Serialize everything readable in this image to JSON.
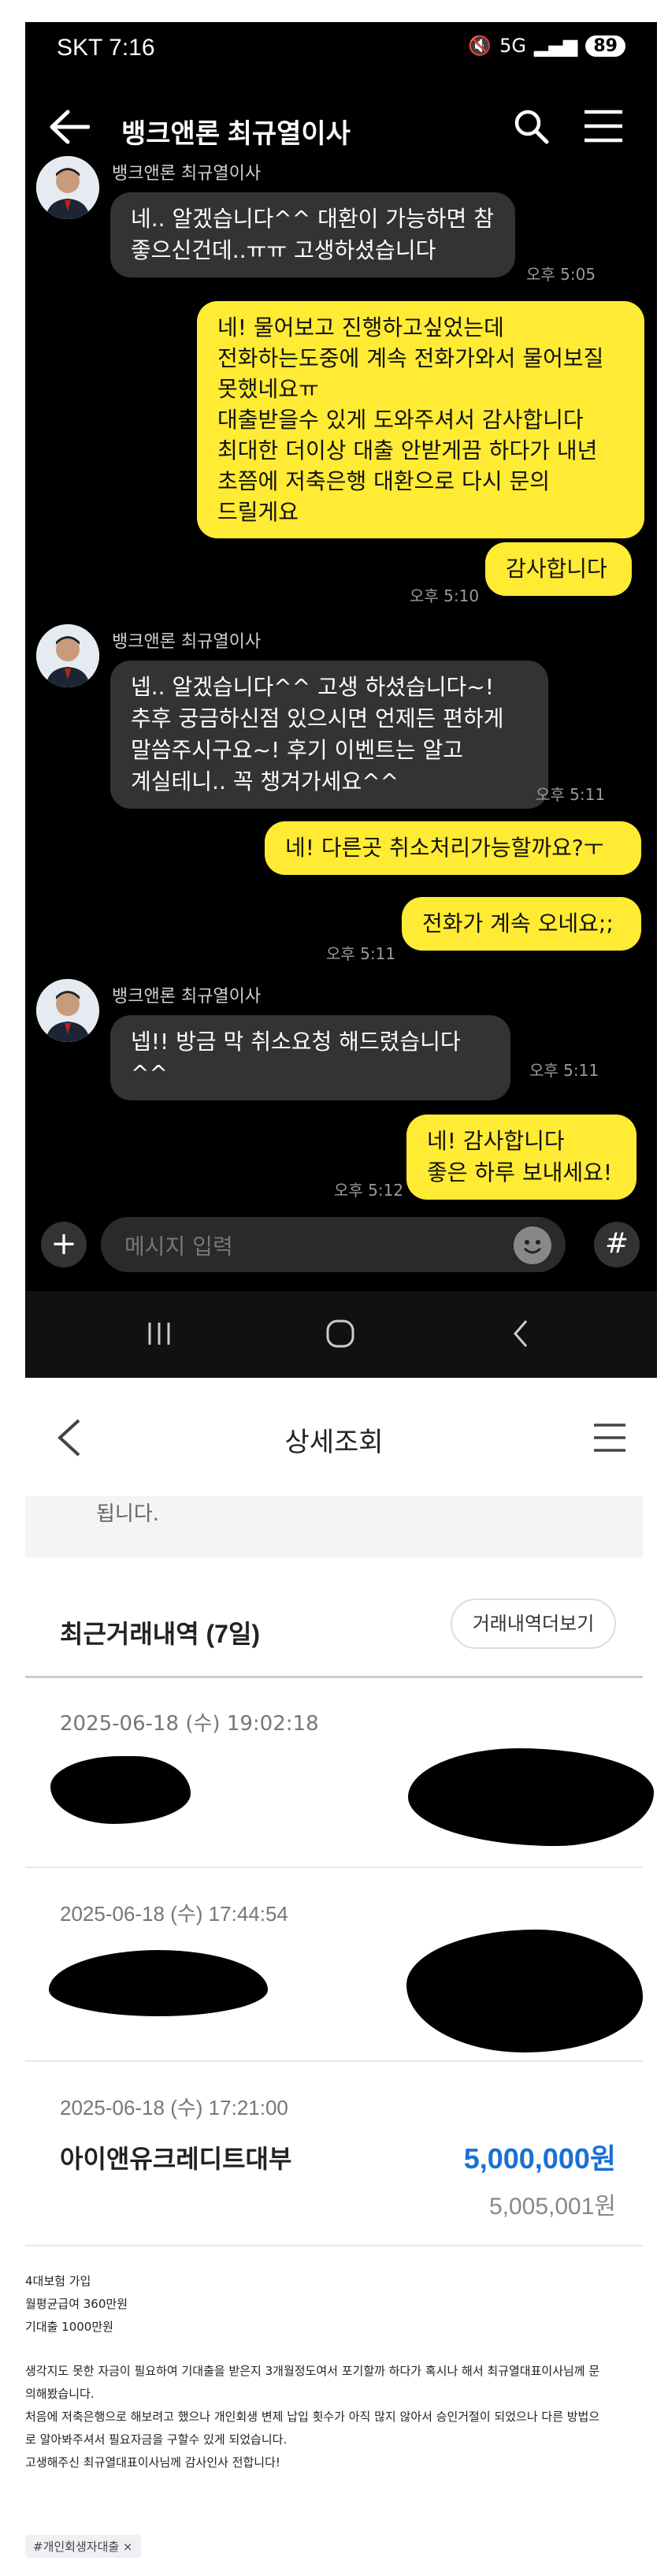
{
  "status": {
    "carrier_time": "SKT 7:16",
    "net": "5G",
    "battery": "89"
  },
  "chat": {
    "title": "뱅크앤론 최규열이사",
    "input_placeholder": "메시지 입력",
    "messages": [
      {
        "from": "other",
        "sender": "뱅크앤론 최규열이사",
        "text": "네.. 알겠습니다^^ 대환이 가능하면 참\n좋으신건데..ㅠㅠ 고생하셨습니다",
        "time": "오후 5:05"
      },
      {
        "from": "me",
        "text": "네! 물어보고 진행하고싶었는데\n전화하는도중에 계속 전화가와서 물어보질\n못했네요ㅠ\n대출받을수 있게 도와주셔서 감사합니다\n최대한 더이상 대출 안받게끔 하다가 내년\n초쯤에 저축은행 대환으로 다시 문의\n드릴게요",
        "time": ""
      },
      {
        "from": "me",
        "text": "감사합니다",
        "time": "오후 5:10"
      },
      {
        "from": "other",
        "sender": "뱅크앤론 최규열이사",
        "text": "넵.. 알겠습니다^^ 고생 하셨습니다~!\n추후 궁금하신점 있으시면 언제든 편하게\n말씀주시구요~! 후기 이벤트는 알고\n계실테니.. 꼭 챙겨가세요^^",
        "time": "오후 5:11"
      },
      {
        "from": "me",
        "text": "네! 다른곳 취소처리가능할까요?ㅜ",
        "time": ""
      },
      {
        "from": "me",
        "text": "전화가 계속 오네요;;",
        "time": "오후 5:11"
      },
      {
        "from": "other",
        "sender": "뱅크앤론 최규열이사",
        "text": "넵!! 방금 막 취소요청 해드렸습니다^^",
        "time": "오후 5:11"
      },
      {
        "from": "me",
        "text": "네! 감사합니다\n좋은 하루 보내세요!",
        "time": "오후 5:12"
      }
    ]
  },
  "detail": {
    "title": "상세조회",
    "prev_text": "됩니다.",
    "section_title": "최근거래내역 (7일)",
    "more_button": "거래내역더보기",
    "transactions": [
      {
        "date": "2025-06-18 (수) 19:02:18"
      },
      {
        "date": "2025-06-18 (수) 17:44:54"
      },
      {
        "date": "2025-06-18 (수) 17:21:00",
        "name": "아이앤유크레디트대부",
        "amount": "5,000,000원",
        "balance": "5,005,001원"
      }
    ]
  },
  "post": {
    "lines_a": [
      "4대보험 가입",
      "월평균급여 360만원",
      "기대출 1000만원"
    ],
    "lines_b": [
      "생각지도 못한 자금이 필요하여 기대출을 받은지 3개월정도여서 포기할까 하다가 혹시나 해서 최규열대표이사님께 문",
      "의해봤습니다.",
      "처음에 저축은행으로 해보려고 했으나 개인회생 변제 납입 횟수가 아직 많지 않아서 승인거절이 되었으나 다른 방법으",
      "로 알아봐주셔서 필요자금을 구할수 있게 되었습니다.",
      "고생해주신 최규열대표이사님께 감사인사 전합니다!"
    ],
    "tag": "#개인회생자대출 ×"
  },
  "colors": {
    "my_bubble": "#ffeb33",
    "their_bubble": "#333333",
    "amount": "#1a6fd6",
    "chat_bg": "#000000"
  }
}
